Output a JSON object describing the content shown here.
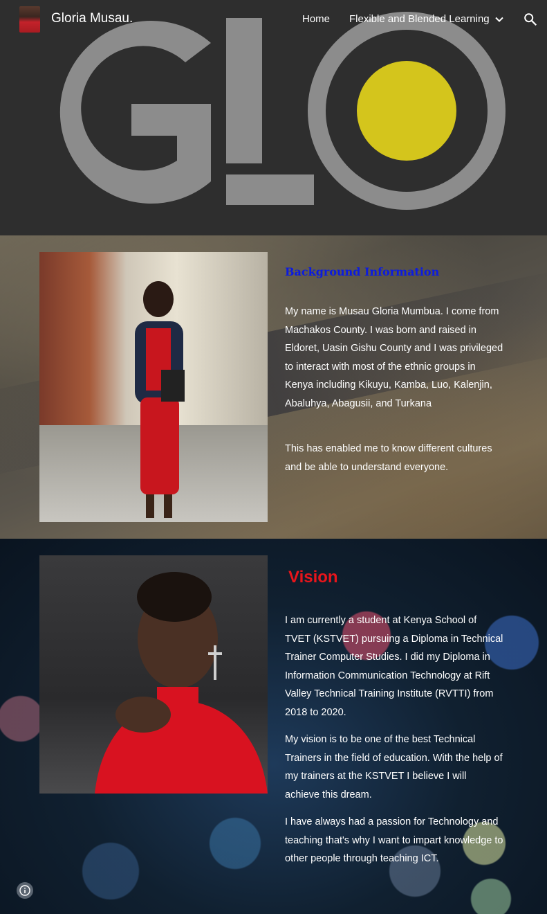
{
  "header": {
    "site_title": "Gloria Musau.",
    "nav": {
      "home_label": "Home",
      "flexible_label": "Flexible and Blended Learning"
    },
    "hero_logo_text": "G!O"
  },
  "section_background": {
    "heading": "Background Information",
    "paragraphs": [
      "My name is  Musau Gloria Mumbua. I come from Machakos County. I was born and raised in Eldoret, Uasin Gishu County and I was privileged to interact with most of the ethnic groups in Kenya including Kikuyu, Kamba, Luo, Kalenjin, Abaluhya, Abagusii, and Turkana",
      " This has enabled me to know different cultures and be able to understand everyone."
    ]
  },
  "section_vision": {
    "heading": "Vision",
    "paragraphs": [
      "I am currently a student at Kenya School of TVET (KSTVET) pursuing a Diploma in Technical Trainer Computer Studies. I did my Diploma in Information Communication Technology at Rift Valley Technical Training Institute (RVTTI)  from 2018 to 2020.",
      "My vision is to be one of the best Technical Trainers in the field of education. With the help of my trainers at  the KSTVET I believe I will achieve this dream.",
      " I have always had a passion for Technology and teaching that's why I want to impart knowledge to other people through teaching ICT."
    ]
  },
  "icons": {
    "nav_dropdown": "chevron-down-icon",
    "search": "search-icon",
    "info": "info-icon"
  },
  "colors": {
    "background_heading": "#0b1be0",
    "vision_heading": "#e8151b",
    "logo_accent": "#d4c51c"
  }
}
